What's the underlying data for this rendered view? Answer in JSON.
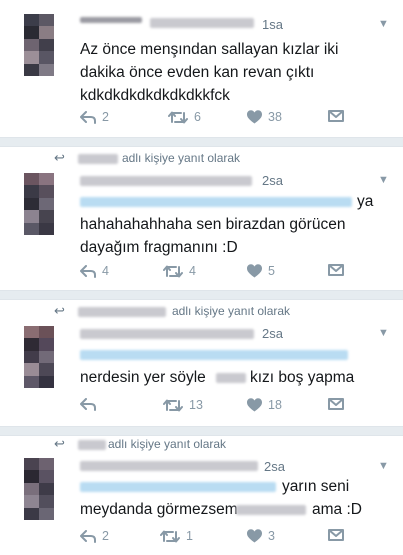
{
  "tweets": [
    {
      "time": "1sa",
      "lines": [
        "Az önce menşından sallayan kızlar iki",
        "dakika önce evden kan revan çıktı",
        "kdkdkdkdkdkdkdkkfck"
      ],
      "replies": "2",
      "retweets": "6",
      "likes": "38"
    },
    {
      "reply_context": "adlı kişiye yanıt olarak",
      "time": "2sa",
      "line1_end": "ya",
      "lines": [
        "hahahahahhaha sen birazdan görücen",
        "dayağım fragmanını :D"
      ],
      "replies": "4",
      "retweets": "4",
      "likes": "5"
    },
    {
      "reply_context": "adlı kişiye yanıt olarak",
      "time": "2sa",
      "text_a": "nerdesin yer söyle",
      "text_b": "kızı boş yapma",
      "replies": "",
      "retweets": "13",
      "likes": "18"
    },
    {
      "reply_context": "adlı kişiye yanıt olarak",
      "time": "2sa",
      "line1_end": "yarın seni",
      "text_a": "meydanda görmezsem",
      "text_b": "ama :D",
      "replies": "2",
      "retweets": "1",
      "likes": "3"
    }
  ],
  "icons": {
    "reply": "reply-icon",
    "retweet": "retweet-icon",
    "like": "heart-icon",
    "dm": "envelope-icon",
    "more": "chevron-down-icon",
    "reply_context": "reply-arrow-icon"
  },
  "colors": {
    "action_gray": "#8899a6",
    "separator": "#e6ecf0",
    "redaction_blue": "#b9dcf2"
  }
}
